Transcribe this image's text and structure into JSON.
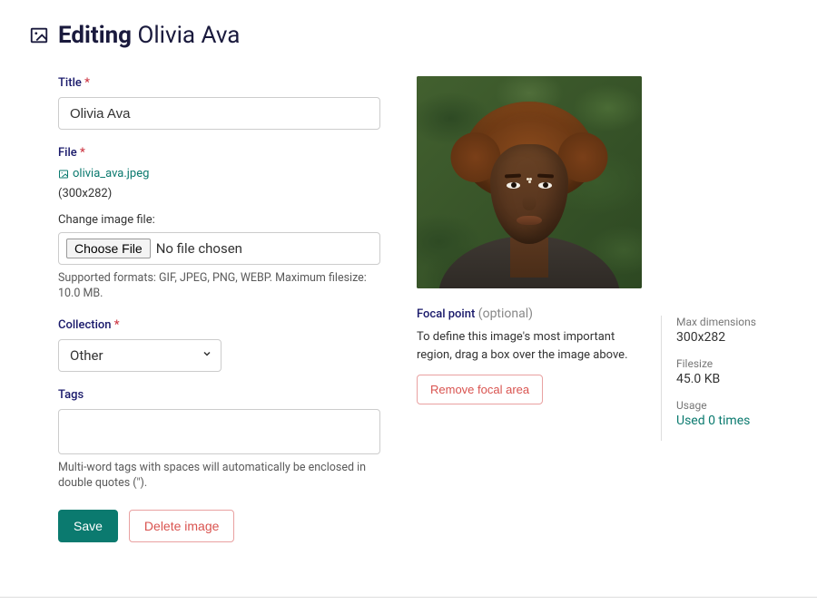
{
  "header": {
    "editing_label": "Editing",
    "image_name": "Olivia Ava"
  },
  "form": {
    "title": {
      "label": "Title",
      "required": "*",
      "value": "Olivia Ava"
    },
    "file": {
      "label": "File",
      "required": "*",
      "filename": "olivia_ava.jpeg",
      "dimensions": "(300x282)",
      "change_label": "Change image file:",
      "choose_button": "Choose File",
      "no_file_text": "No file chosen",
      "help": "Supported formats: GIF, JPEG, PNG, WEBP. Maximum filesize: 10.0 MB."
    },
    "collection": {
      "label": "Collection",
      "required": "*",
      "value": "Other"
    },
    "tags": {
      "label": "Tags",
      "value": "",
      "help": "Multi-word tags with spaces will automatically be enclosed in double quotes (\")."
    },
    "actions": {
      "save": "Save",
      "delete": "Delete image"
    }
  },
  "focal": {
    "title": "Focal point",
    "optional": "(optional)",
    "description": "To define this image's most important region, drag a box over the image above.",
    "remove_button": "Remove focal area"
  },
  "meta": {
    "max_dim_label": "Max dimensions",
    "max_dim_value": "300x282",
    "filesize_label": "Filesize",
    "filesize_value": "45.0 KB",
    "usage_label": "Usage",
    "usage_value": "Used 0 times"
  }
}
